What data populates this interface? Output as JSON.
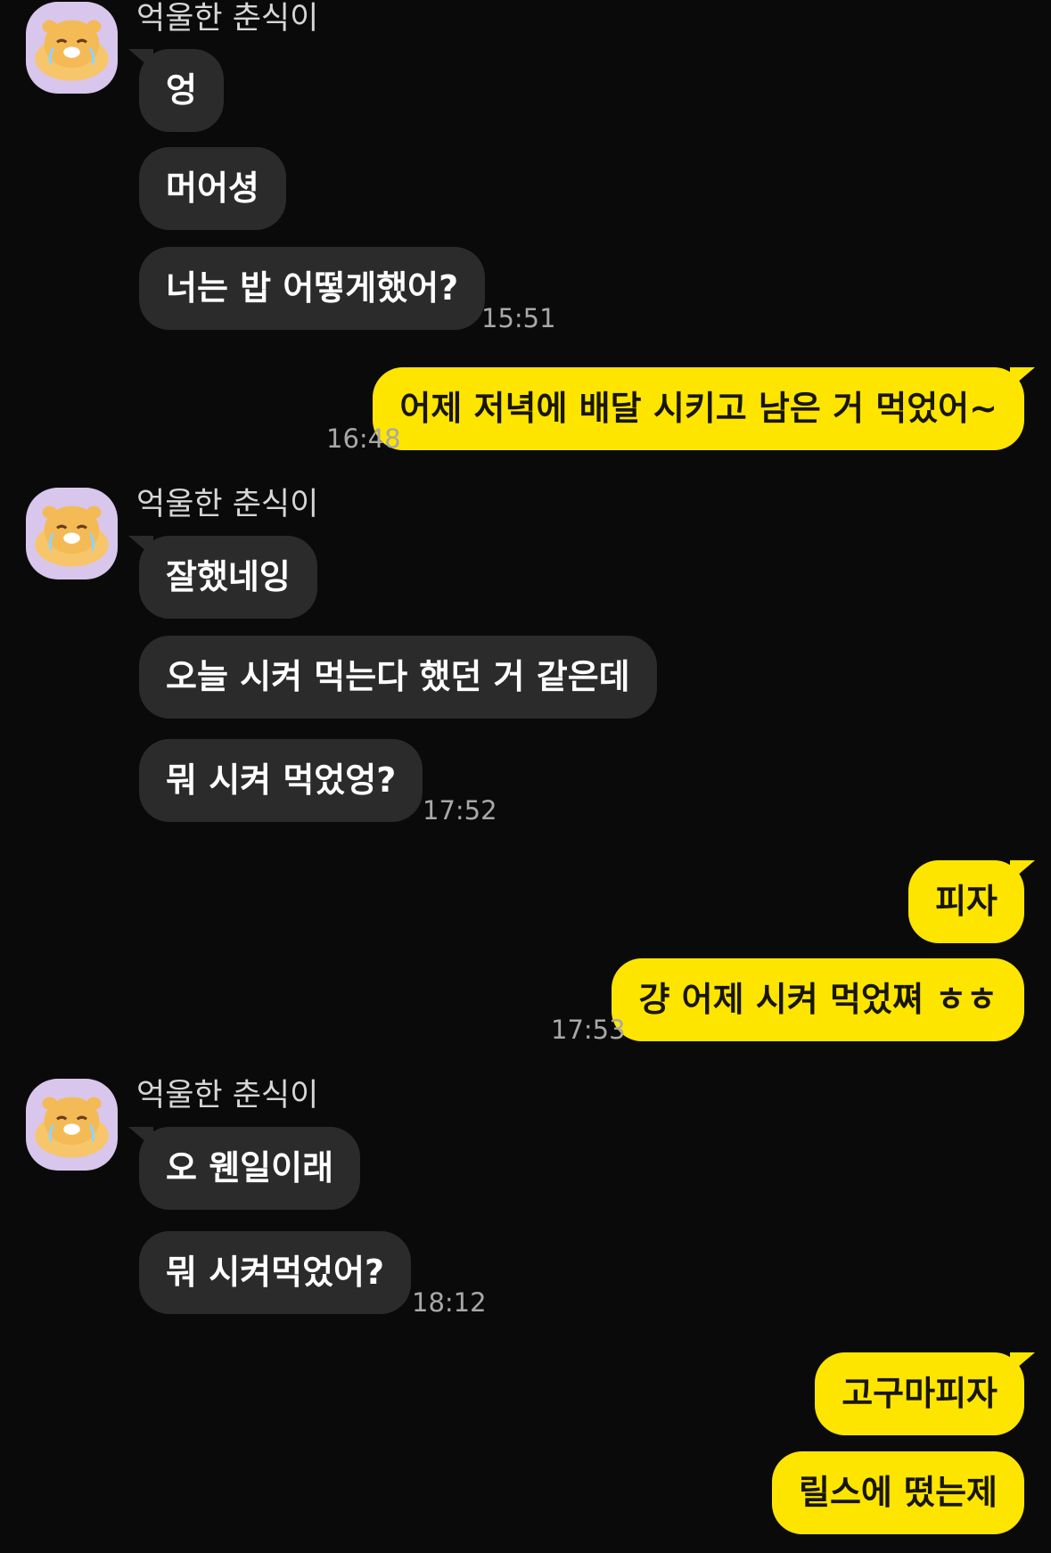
{
  "groups": [
    {
      "sender": "억울한 춘식이",
      "messages": [
        "엉",
        "머어셩",
        "너는 밥 어떻게했어?"
      ],
      "time": "15:51"
    },
    {
      "outgoing": [
        "어제 저녁에 배달 시키고 남은 거 먹었어~"
      ],
      "time": "16:48"
    },
    {
      "sender": "억울한 춘식이",
      "messages": [
        "잘했네잉",
        "오늘 시켜 먹는다 했던 거 같은데",
        "뭐 시켜 먹었엉?"
      ],
      "time": "17:52"
    },
    {
      "outgoing": [
        "피자",
        "걍 어제 시켜 먹었쪄 ㅎㅎ"
      ],
      "time": "17:53"
    },
    {
      "sender": "억울한 춘식이",
      "messages": [
        "오 웬일이래",
        "뭐 시켜먹었어?"
      ],
      "time": "18:12"
    },
    {
      "outgoing": [
        "고구마피자",
        "릴스에 떴는제"
      ]
    }
  ],
  "colors": {
    "background": "#0a0a0a",
    "incoming_bubble": "#2b2b2b",
    "outgoing_bubble": "#fee500",
    "avatar_bg": "#d9c6ec"
  },
  "icons": {
    "avatar": "choonsik-crying-avatar-icon"
  }
}
